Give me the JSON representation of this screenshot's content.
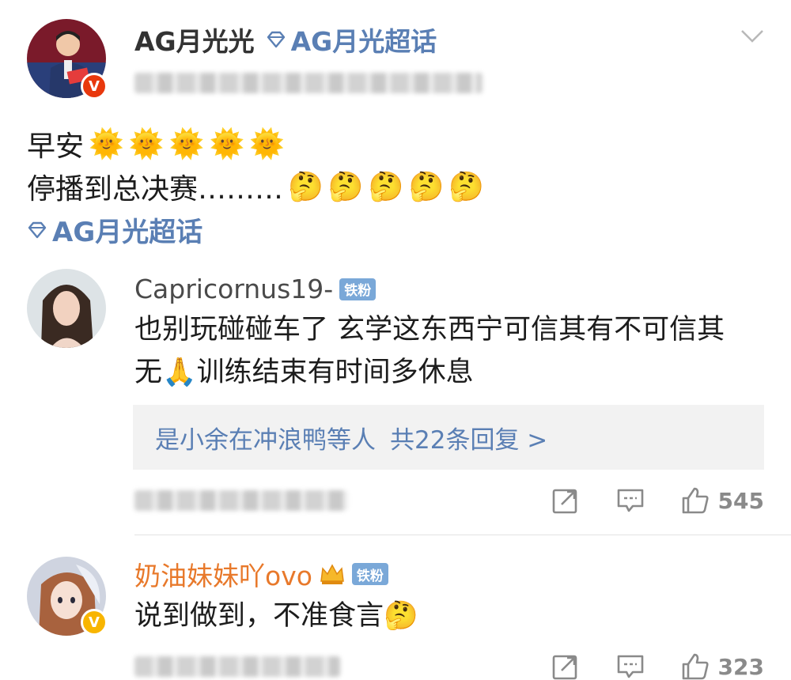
{
  "post": {
    "author": "AG月光光",
    "supertopic_label": "AG月光超话",
    "line1": "早安",
    "line2": "停播到总决赛………",
    "topic_link": "AG月光超话",
    "sun_emoji": "🌞",
    "think_emoji": "🤔"
  },
  "comments": [
    {
      "name": "Capricornus19-",
      "badge": "铁粉",
      "text_line1": "也别玩碰碰车了 玄学这东西宁可信其有不可信其",
      "text_line2_pre": "无",
      "text_line2_emoji": "🙏",
      "text_line2_post": "训练结束有时间多休息",
      "replies_users": "是小余在冲浪鸭等人",
      "replies_count": "共22条回复 >",
      "likes": "545"
    },
    {
      "name": "奶油妹妹吖ovo",
      "badge": "铁粉",
      "name_color": "#e8792b",
      "text": "说到做到，不准食言",
      "text_emoji": "🤔",
      "likes": "323"
    }
  ],
  "icons": {
    "verified_red": "V",
    "verified_yellow": "V",
    "colors": {
      "link": "#5a7fb4",
      "orange_name": "#e8792b",
      "verified_red": "#e8380d",
      "verified_yellow": "#f8b500"
    }
  }
}
